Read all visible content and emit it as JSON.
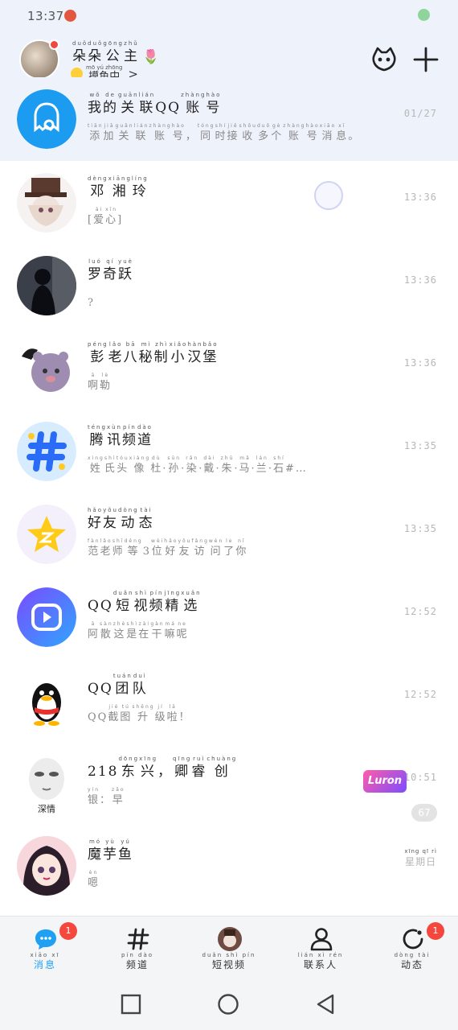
{
  "status_bar": {
    "time": "13:37"
  },
  "header": {
    "name": [
      [
        "duǒ",
        "朵"
      ],
      [
        "duǒ",
        "朵"
      ],
      [
        "gōng",
        "公"
      ],
      [
        "zhǔ",
        "主"
      ]
    ],
    "name_suffix": "🌷",
    "status": "摸鱼中",
    "status_pinyin": "mō yú zhōng",
    "status_arrow": ">"
  },
  "conversations": [
    {
      "title": [
        [
          "wǒ",
          "我"
        ],
        [
          "de",
          "的"
        ],
        [
          "guān",
          "关"
        ],
        [
          "lián",
          "联"
        ],
        [
          "",
          "QQ"
        ],
        [
          "zhàng",
          "账"
        ],
        [
          "hào",
          "号"
        ]
      ],
      "subtitle": [
        [
          "tiān",
          "添"
        ],
        [
          "jiā",
          "加"
        ],
        [
          "guān",
          "关"
        ],
        [
          "lián",
          "联"
        ],
        [
          "zhàng",
          "账"
        ],
        [
          "hào",
          "号"
        ],
        [
          "",
          "，"
        ],
        [
          "tóng",
          "同"
        ],
        [
          "shí",
          "时"
        ],
        [
          "jiē",
          "接"
        ],
        [
          "shōu",
          "收"
        ],
        [
          "duō",
          "多"
        ],
        [
          "gè",
          "个"
        ],
        [
          "zhàng",
          "账"
        ],
        [
          "hào",
          "号"
        ],
        [
          "xiāo",
          "消"
        ],
        [
          "xī",
          "息"
        ],
        [
          "",
          "。"
        ]
      ],
      "time": "01/27",
      "avatar": "qq-link-icon",
      "pinned": true
    },
    {
      "title": [
        [
          "dèng",
          "邓"
        ],
        [
          "xiāng",
          "湘"
        ],
        [
          "líng",
          "玲"
        ]
      ],
      "subtitle": [
        [
          "",
          "["
        ],
        [
          "ài",
          "爱"
        ],
        [
          "xīn",
          "心"
        ],
        [
          "",
          "]"
        ]
      ],
      "time": "13:36",
      "avatar": "anime-top-hat"
    },
    {
      "title": [
        [
          "luó",
          "罗"
        ],
        [
          "qí",
          "奇"
        ],
        [
          "yuè",
          "跃"
        ]
      ],
      "subtitle": [
        [
          "",
          "?"
        ]
      ],
      "time": "13:36",
      "avatar": "silhouette-photo"
    },
    {
      "title": [
        [
          "péng",
          "彭"
        ],
        [
          "lǎo",
          "老"
        ],
        [
          "bā",
          "八"
        ],
        [
          "mì",
          "秘"
        ],
        [
          "zhì",
          "制"
        ],
        [
          "xiǎo",
          "小"
        ],
        [
          "hàn",
          "汉"
        ],
        [
          "bǎo",
          "堡"
        ]
      ],
      "subtitle": [
        [
          "ā",
          "啊"
        ],
        [
          "lè",
          "勒"
        ]
      ],
      "time": "13:36",
      "avatar": "bear-cartoon"
    },
    {
      "title": [
        [
          "téng",
          "腾"
        ],
        [
          "xùn",
          "讯"
        ],
        [
          "pín",
          "频"
        ],
        [
          "dào",
          "道"
        ]
      ],
      "subtitle": [
        [
          "xìng",
          "姓"
        ],
        [
          "shì",
          "氏"
        ],
        [
          "tóu",
          "头"
        ],
        [
          "xiàng",
          "像"
        ],
        [
          "dù",
          "杜"
        ],
        [
          "",
          "·"
        ],
        [
          "sūn",
          "孙"
        ],
        [
          "",
          "·"
        ],
        [
          "rǎn",
          "染"
        ],
        [
          "",
          "·"
        ],
        [
          "dài",
          "戴"
        ],
        [
          "",
          "·"
        ],
        [
          "zhū",
          "朱"
        ],
        [
          "",
          "·"
        ],
        [
          "mǎ",
          "马"
        ],
        [
          "",
          "·"
        ],
        [
          "lán",
          "兰"
        ],
        [
          "",
          "·"
        ],
        [
          "shí",
          "石"
        ],
        [
          "",
          "#…"
        ]
      ],
      "time": "13:35",
      "avatar": "channel-hash-icon"
    },
    {
      "title": [
        [
          "hǎo",
          "好"
        ],
        [
          "yǒu",
          "友"
        ],
        [
          "dòng",
          "动"
        ],
        [
          "tài",
          "态"
        ]
      ],
      "subtitle": [
        [
          "fàn",
          "范"
        ],
        [
          "lǎo",
          "老"
        ],
        [
          "shī",
          "师"
        ],
        [
          "děng",
          "等"
        ],
        [
          "",
          "3"
        ],
        [
          "wèi",
          "位"
        ],
        [
          "hǎo",
          "好"
        ],
        [
          "yǒu",
          "友"
        ],
        [
          "fǎng",
          "访"
        ],
        [
          "wèn",
          "问"
        ],
        [
          "le",
          "了"
        ],
        [
          "nǐ",
          "你"
        ]
      ],
      "time": "13:35",
      "avatar": "qzone-star-icon"
    },
    {
      "title": [
        [
          "",
          "QQ"
        ],
        [
          "duǎn",
          "短"
        ],
        [
          "shì",
          "视"
        ],
        [
          "pín",
          "频"
        ],
        [
          "jīng",
          "精"
        ],
        [
          "xuǎn",
          "选"
        ]
      ],
      "subtitle": [
        [
          "ā",
          "阿"
        ],
        [
          "sàn",
          "散"
        ],
        [
          "zhè",
          "这"
        ],
        [
          "shì",
          "是"
        ],
        [
          "zài",
          "在"
        ],
        [
          "gàn",
          "干"
        ],
        [
          "má",
          "嘛"
        ],
        [
          "ne",
          "呢"
        ]
      ],
      "time": "12:52",
      "avatar": "short-video-icon"
    },
    {
      "title": [
        [
          "",
          "QQ"
        ],
        [
          "tuán",
          "团"
        ],
        [
          "duì",
          "队"
        ]
      ],
      "subtitle": [
        [
          "",
          "QQ"
        ],
        [
          "jié",
          "截"
        ],
        [
          "tú",
          "图"
        ],
        [
          "shēng",
          "升"
        ],
        [
          "jí",
          "级"
        ],
        [
          "lā",
          "啦"
        ],
        [
          "",
          "！"
        ]
      ],
      "time": "12:52",
      "avatar": "penguin-icon"
    },
    {
      "title": [
        [
          "",
          "218"
        ],
        [
          "dōng",
          "东"
        ],
        [
          "xīng",
          "兴"
        ],
        [
          "",
          "，"
        ],
        [
          "qīng",
          "卿"
        ],
        [
          "ruì",
          "睿"
        ],
        [
          "chuàng",
          "创"
        ]
      ],
      "subtitle": [
        [
          "yín",
          "银"
        ],
        [
          "",
          "："
        ],
        [
          "zǎo",
          "早"
        ]
      ],
      "time": "10:51",
      "avatar": "deep-love-face",
      "avatar_label": "深情",
      "tag": "Luron",
      "badge": "67"
    },
    {
      "title": [
        [
          "mó",
          "魔"
        ],
        [
          "yù",
          "芋"
        ],
        [
          "yú",
          "鱼"
        ]
      ],
      "subtitle": [
        [
          "èn",
          "嗯"
        ]
      ],
      "time": "星期日",
      "time_pinyin": "xīng qī rì",
      "avatar": "anime-girl"
    }
  ],
  "tabs": [
    {
      "label": "消息",
      "pinyin": "xiāo xī",
      "icon": "message-bubble-icon",
      "badge": "1",
      "active": true
    },
    {
      "label": "频道",
      "pinyin": "pín dào",
      "icon": "hash-icon"
    },
    {
      "label": "短视频",
      "pinyin": "duǎn shì pín",
      "icon": "short-video-avatar-icon"
    },
    {
      "label": "联系人",
      "pinyin": "lián xì rén",
      "icon": "person-icon"
    },
    {
      "label": "动态",
      "pinyin": "dòng tài",
      "icon": "refresh-circle-icon",
      "badge": "1"
    }
  ],
  "colors": {
    "accent": "#1fa0f2",
    "header_bg": "#eef2fb",
    "badge_red": "#f4473d",
    "muted": "#b7b7b7"
  }
}
